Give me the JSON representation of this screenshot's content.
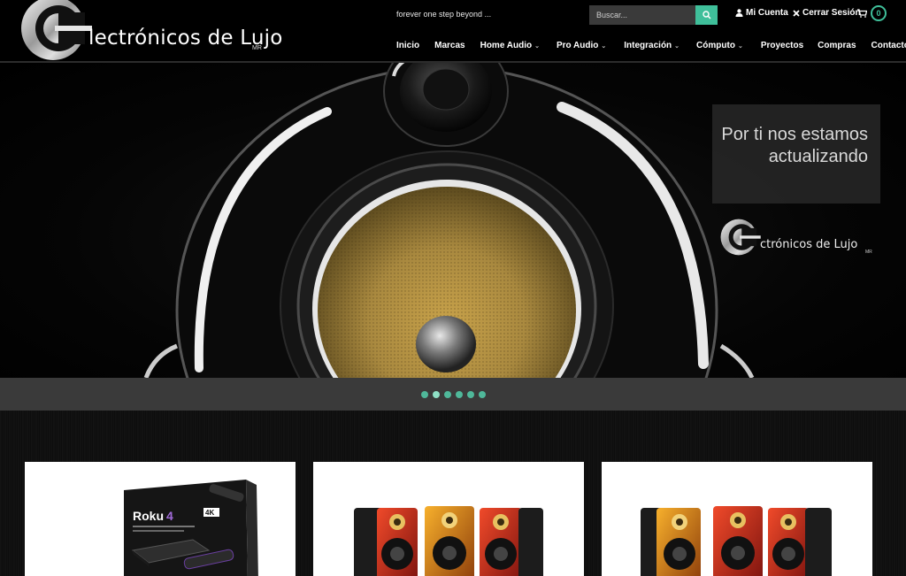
{
  "brand": {
    "name": "lectrónicos de Lujo",
    "mark": "MR"
  },
  "header": {
    "tagline": "forever one step beyond ...",
    "search": {
      "placeholder": "Buscar..."
    },
    "account_label": "Mi Cuenta",
    "logout_label": "Cerrar Sesión",
    "cart_count": "0"
  },
  "nav": {
    "items": [
      {
        "label": "Inicio",
        "dropdown": false
      },
      {
        "label": "Marcas",
        "dropdown": false
      },
      {
        "label": "Home Audio",
        "dropdown": true
      },
      {
        "label": "Pro Audio",
        "dropdown": true
      },
      {
        "label": "Integración",
        "dropdown": true
      },
      {
        "label": "Cómputo",
        "dropdown": true
      },
      {
        "label": "Proyectos",
        "dropdown": false
      },
      {
        "label": "Compras",
        "dropdown": false
      },
      {
        "label": "Contacto",
        "dropdown": false
      }
    ]
  },
  "hero": {
    "promo_line1": "Por ti nos estamos",
    "promo_line2": "actualizando",
    "logo_text": "ctrónicos de Lujo",
    "logo_mark": "MR"
  },
  "slider": {
    "count": 6,
    "active_index": 1
  },
  "products": {
    "roku": {
      "brand": "Roku",
      "model": "4",
      "badge": "4K"
    }
  },
  "colors": {
    "accent": "#3fbf9a",
    "background": "#000000",
    "dots_bar": "#3a3a3a"
  },
  "icons": [
    "search-icon",
    "user-icon",
    "close-icon",
    "cart-icon"
  ]
}
